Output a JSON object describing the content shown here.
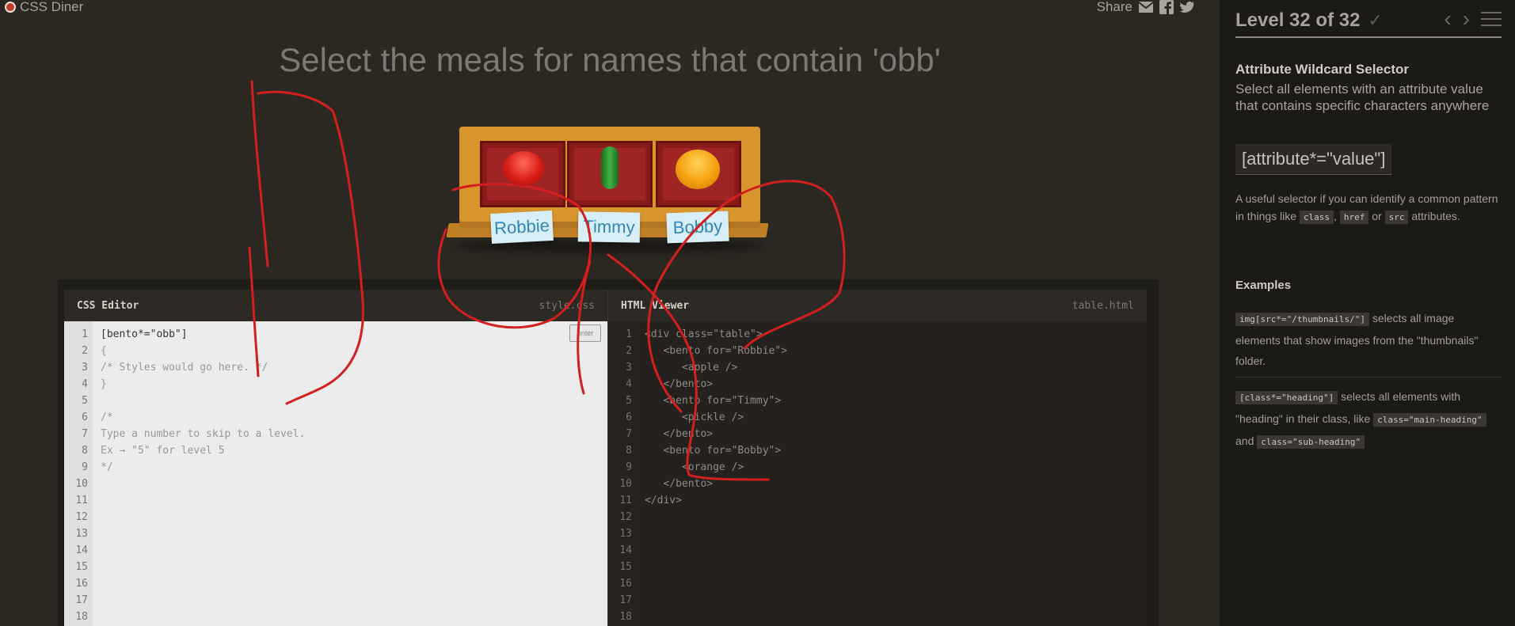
{
  "app": {
    "logo_label": "CSS Diner"
  },
  "share": {
    "label": "Share",
    "icons": [
      "mail-icon",
      "facebook-icon",
      "twitter-icon"
    ]
  },
  "order": "Select the meals for names that contain 'obb'",
  "table": {
    "items": [
      {
        "name": "Robbie",
        "food": "apple"
      },
      {
        "name": "Timmy",
        "food": "pickle"
      },
      {
        "name": "Bobby",
        "food": "orange"
      }
    ]
  },
  "css_editor": {
    "title": "CSS Editor",
    "file": "style.css",
    "enter_label": "enter",
    "input_value": "[bento*=\"obb\"]",
    "lines": [
      "{",
      "/* Styles would go here. */",
      "}",
      "",
      "/*",
      "Type a number to skip to a level.",
      "Ex → \"5\" for level 5",
      "*/"
    ],
    "line_numbers": [
      "1",
      "2",
      "3",
      "4",
      "5",
      "6",
      "7",
      "8",
      "9",
      "10",
      "11",
      "12",
      "13",
      "14",
      "15",
      "16",
      "17",
      "18"
    ]
  },
  "html_viewer": {
    "title": "HTML Viewer",
    "file": "table.html",
    "lines": [
      "<div class=\"table\">",
      "   <bento for=\"Robbie\">",
      "      <apple />",
      "   </bento>",
      "   <bento for=\"Timmy\">",
      "      <pickle />",
      "   </bento>",
      "   <bento for=\"Bobby\">",
      "      <orange />",
      "   </bento>",
      "</div>"
    ],
    "line_numbers": [
      "1",
      "2",
      "3",
      "4",
      "5",
      "6",
      "7",
      "8",
      "9",
      "10",
      "11",
      "12",
      "13",
      "14",
      "15",
      "16",
      "17",
      "18"
    ]
  },
  "sidebar": {
    "level_text": "Level 32 of 32",
    "progress": 1.0,
    "selector_name": "Attribute Wildcard Selector",
    "title": "Select all elements with an attribute value that contains specific characters anywhere",
    "syntax": "[attribute*=\"value\"]",
    "hint": {
      "prefix": "A useful selector if you can identify a common pattern in things like ",
      "code1": "class",
      "sep1": ", ",
      "code2": "href",
      "sep2": " or ",
      "code3": "src",
      "suffix": " attributes."
    },
    "examples_heading": "Examples",
    "examples": [
      {
        "code": "img[src*=\"/thumbnails/\"]",
        "text": " selects all image elements that show images from the \"thumbnails\" folder."
      },
      {
        "code": "[class*=\"heading\"]",
        "text_a": " selects all elements with \"heading\" in their class, like ",
        "code_b": "class=\"main-heading\"",
        "text_c": " and ",
        "code_d": "class=\"sub-heading\""
      }
    ]
  },
  "colors": {
    "annotation": "#d41f1f",
    "background": "#2b2721",
    "sidebar": "#1c1a17"
  }
}
